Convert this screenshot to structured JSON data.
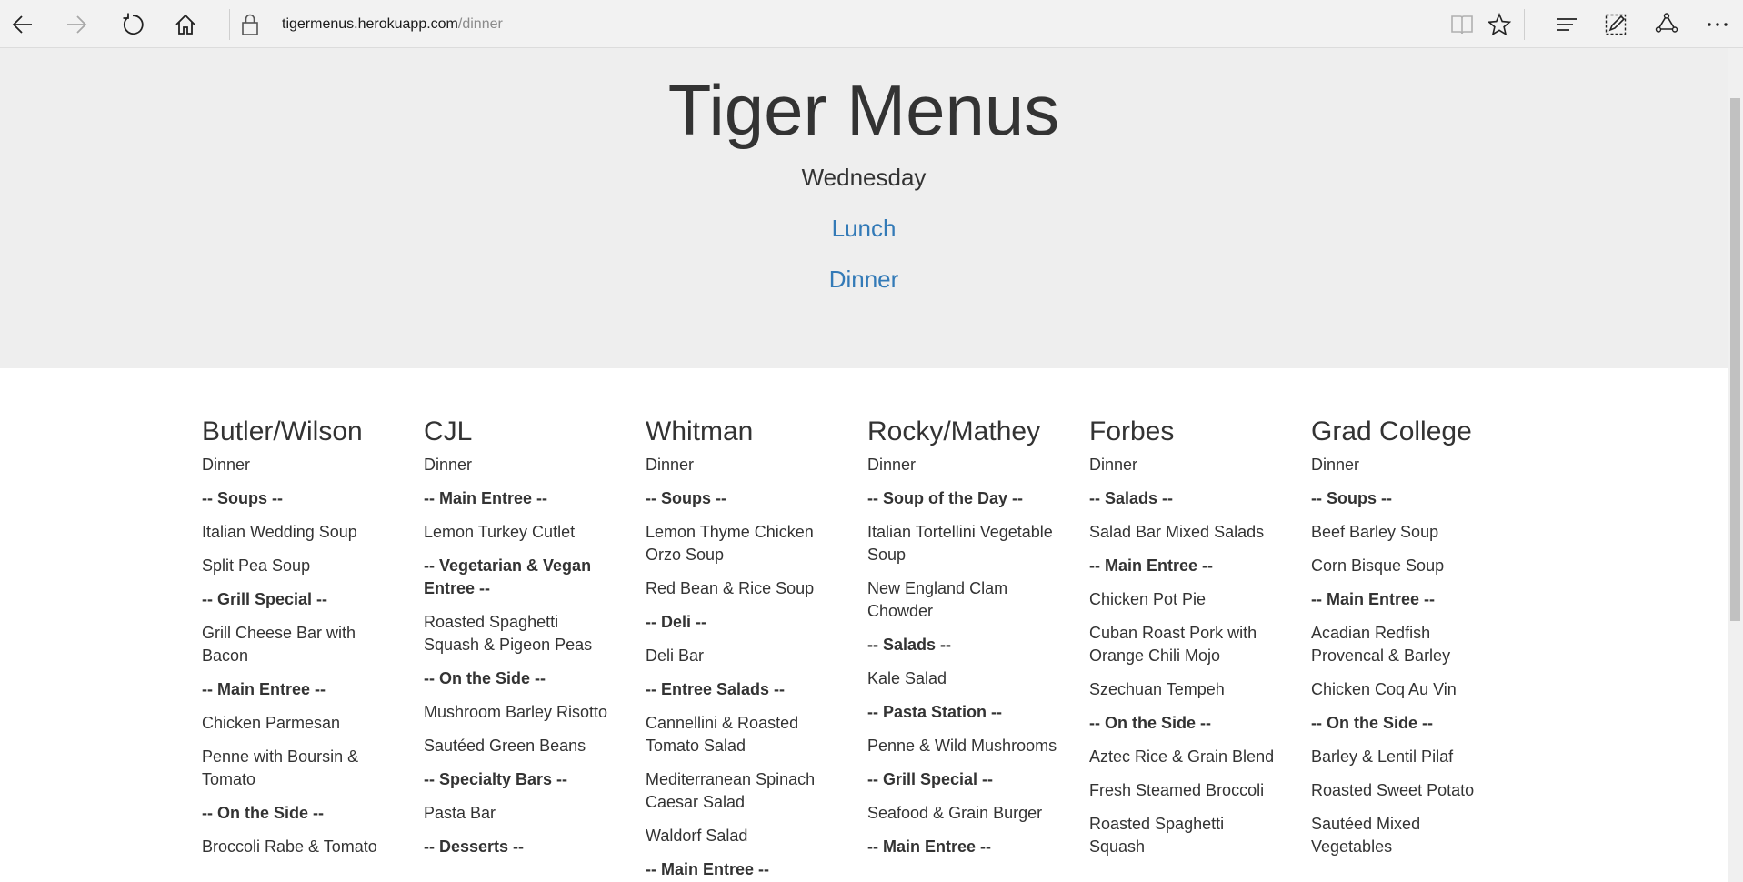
{
  "browser": {
    "url_host": "tigermenus.herokuapp.com",
    "url_path": "/dinner"
  },
  "page": {
    "title": "Tiger Menus",
    "day": "Wednesday",
    "links": {
      "lunch": "Lunch",
      "dinner": "Dinner"
    },
    "link_color": "#337ab7",
    "header_bg": "#eeeeee"
  },
  "halls": [
    {
      "name": "Butler/Wilson",
      "meal": "Dinner",
      "items": [
        {
          "text": "-- Soups --",
          "section": true
        },
        {
          "text": "Italian Wedding Soup",
          "section": false
        },
        {
          "text": "Split Pea Soup",
          "section": false
        },
        {
          "text": "-- Grill Special --",
          "section": true
        },
        {
          "text": "Grill Cheese Bar with Bacon",
          "section": false
        },
        {
          "text": "-- Main Entree --",
          "section": true
        },
        {
          "text": "Chicken Parmesan",
          "section": false
        },
        {
          "text": "Penne with Boursin & Tomato",
          "section": false
        },
        {
          "text": "-- On the Side --",
          "section": true
        },
        {
          "text": "Broccoli Rabe & Tomato",
          "section": false
        }
      ]
    },
    {
      "name": "CJL",
      "meal": "Dinner",
      "items": [
        {
          "text": "-- Main Entree --",
          "section": true
        },
        {
          "text": "Lemon Turkey Cutlet",
          "section": false
        },
        {
          "text": "-- Vegetarian & Vegan Entree --",
          "section": true
        },
        {
          "text": "Roasted Spaghetti Squash & Pigeon Peas",
          "section": false
        },
        {
          "text": "-- On the Side --",
          "section": true
        },
        {
          "text": "Mushroom Barley Risotto",
          "section": false
        },
        {
          "text": "Sautéed Green Beans",
          "section": false
        },
        {
          "text": "-- Specialty Bars --",
          "section": true
        },
        {
          "text": "Pasta Bar",
          "section": false
        },
        {
          "text": "-- Desserts --",
          "section": true
        }
      ]
    },
    {
      "name": "Whitman",
      "meal": "Dinner",
      "items": [
        {
          "text": "-- Soups --",
          "section": true
        },
        {
          "text": "Lemon Thyme Chicken Orzo Soup",
          "section": false
        },
        {
          "text": "Red Bean & Rice Soup",
          "section": false
        },
        {
          "text": "-- Deli --",
          "section": true
        },
        {
          "text": "Deli Bar",
          "section": false
        },
        {
          "text": "-- Entree Salads --",
          "section": true
        },
        {
          "text": "Cannellini & Roasted Tomato Salad",
          "section": false
        },
        {
          "text": "Mediterranean Spinach Caesar Salad",
          "section": false
        },
        {
          "text": "Waldorf Salad",
          "section": false
        },
        {
          "text": "-- Main Entree --",
          "section": true
        }
      ]
    },
    {
      "name": "Rocky/Mathey",
      "meal": "Dinner",
      "items": [
        {
          "text": "-- Soup of the Day --",
          "section": true
        },
        {
          "text": "Italian Tortellini Vegetable Soup",
          "section": false
        },
        {
          "text": "New England Clam Chowder",
          "section": false
        },
        {
          "text": "-- Salads --",
          "section": true
        },
        {
          "text": "Kale Salad",
          "section": false
        },
        {
          "text": "-- Pasta Station --",
          "section": true
        },
        {
          "text": "Penne & Wild Mushrooms",
          "section": false
        },
        {
          "text": "-- Grill Special --",
          "section": true
        },
        {
          "text": "Seafood & Grain Burger",
          "section": false
        },
        {
          "text": "-- Main Entree --",
          "section": true
        }
      ]
    },
    {
      "name": "Forbes",
      "meal": "Dinner",
      "items": [
        {
          "text": "-- Salads --",
          "section": true
        },
        {
          "text": "Salad Bar Mixed Salads",
          "section": false
        },
        {
          "text": "-- Main Entree --",
          "section": true
        },
        {
          "text": "Chicken Pot Pie",
          "section": false
        },
        {
          "text": "Cuban Roast Pork with Orange Chili Mojo",
          "section": false
        },
        {
          "text": "Szechuan Tempeh",
          "section": false
        },
        {
          "text": "-- On the Side --",
          "section": true
        },
        {
          "text": "Aztec Rice & Grain Blend",
          "section": false
        },
        {
          "text": "Fresh Steamed Broccoli",
          "section": false
        },
        {
          "text": "Roasted Spaghetti Squash",
          "section": false
        }
      ]
    },
    {
      "name": "Grad College",
      "meal": "Dinner",
      "items": [
        {
          "text": "-- Soups --",
          "section": true
        },
        {
          "text": "Beef Barley Soup",
          "section": false
        },
        {
          "text": "Corn Bisque Soup",
          "section": false
        },
        {
          "text": "-- Main Entree --",
          "section": true
        },
        {
          "text": "Acadian Redfish Provencal & Barley",
          "section": false
        },
        {
          "text": "Chicken Coq Au Vin",
          "section": false
        },
        {
          "text": "-- On the Side --",
          "section": true
        },
        {
          "text": "Barley & Lentil Pilaf",
          "section": false
        },
        {
          "text": "Roasted Sweet Potato",
          "section": false
        },
        {
          "text": "Sautéed Mixed Vegetables",
          "section": false
        }
      ]
    }
  ],
  "icons": {
    "back": "back-arrow-icon",
    "forward": "forward-arrow-icon",
    "refresh": "refresh-icon",
    "home": "home-icon",
    "lock": "lock-icon",
    "reading_view": "reading-view-icon",
    "favorite": "star-icon",
    "hub": "hub-icon",
    "web_note": "web-note-icon",
    "share": "share-icon",
    "more": "more-icon"
  }
}
